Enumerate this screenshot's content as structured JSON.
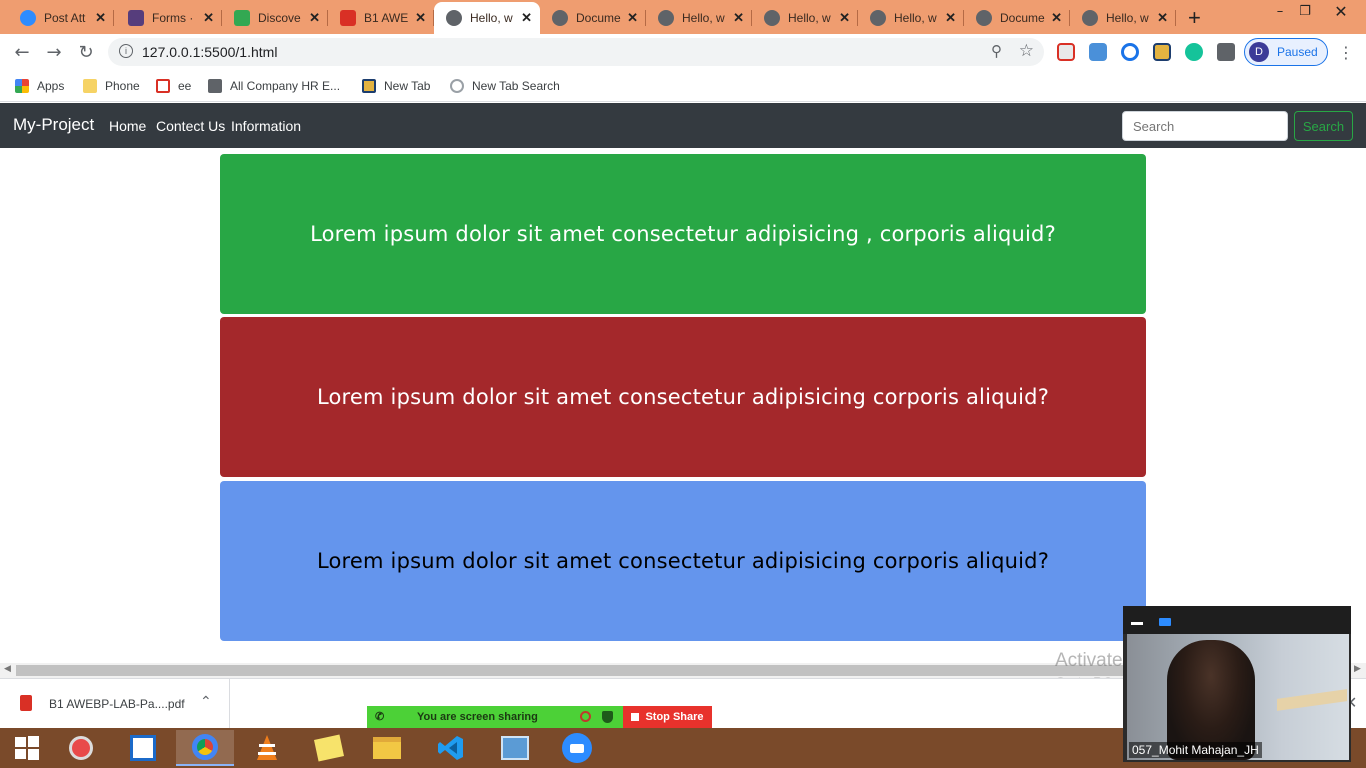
{
  "browser": {
    "tabs": [
      {
        "title": "Post Att",
        "icon": "zoom-icon",
        "color": "#2d8cff"
      },
      {
        "title": "Forms ·",
        "icon": "bootstrap-icon",
        "color": "#563d7c"
      },
      {
        "title": "Discove",
        "icon": "pixel-icon",
        "color": "#33a852"
      },
      {
        "title": "B1 AWE",
        "icon": "pdf-icon",
        "color": "#d93025"
      },
      {
        "title": "Hello, w",
        "icon": "globe-icon",
        "color": "#5f6368",
        "active": true
      },
      {
        "title": "Docume",
        "icon": "globe-icon",
        "color": "#5f6368"
      },
      {
        "title": "Hello, w",
        "icon": "globe-icon",
        "color": "#5f6368"
      },
      {
        "title": "Hello, w",
        "icon": "globe-icon",
        "color": "#5f6368"
      },
      {
        "title": "Hello, w",
        "icon": "globe-icon",
        "color": "#5f6368"
      },
      {
        "title": "Docume",
        "icon": "globe-icon",
        "color": "#5f6368"
      },
      {
        "title": "Hello, w",
        "icon": "globe-icon",
        "color": "#5f6368"
      }
    ],
    "new_tab_label": "+",
    "url": "127.0.0.1:5500/1.html",
    "profile_initial": "D",
    "profile_status": "Paused",
    "bookmarks": [
      {
        "label": "Apps",
        "icon": "apps-grid-icon"
      },
      {
        "label": "Phone",
        "icon": "folder-icon"
      },
      {
        "label": "ee",
        "icon": "gmail-icon"
      },
      {
        "label": "All Company HR E...",
        "icon": "doc-icon"
      },
      {
        "label": "New Tab",
        "icon": "box-icon"
      },
      {
        "label": "New Tab Search",
        "icon": "search-icon"
      }
    ]
  },
  "page": {
    "brand": "My-Project",
    "nav_links": [
      "Home",
      "Contect Us",
      "Information"
    ],
    "search_placeholder": "Search",
    "search_button": "Search",
    "cards": [
      {
        "text": "Lorem ipsum dolor sit amet consectetur adipisicing , corporis aliquid?",
        "bg": "#28a745",
        "fg": "#ffffff"
      },
      {
        "text": "Lorem ipsum dolor sit amet consectetur adipisicing corporis aliquid?",
        "bg": "#a4282b",
        "fg": "#ffffff"
      },
      {
        "text": "Lorem ipsum dolor sit amet consectetur adipisicing corporis aliquid?",
        "bg": "#6495ed",
        "fg": "#000000"
      }
    ]
  },
  "download": {
    "filename": "B1 AWEBP-LAB-Pa....pdf"
  },
  "screenshare": {
    "status": "You are screen sharing",
    "stop_label": "Stop Share"
  },
  "video": {
    "participant": "057_Mohit Mahajan_JH"
  },
  "watermark": {
    "line1": "Activate Windows",
    "line2": "Go to PC settings to activate Windows."
  }
}
